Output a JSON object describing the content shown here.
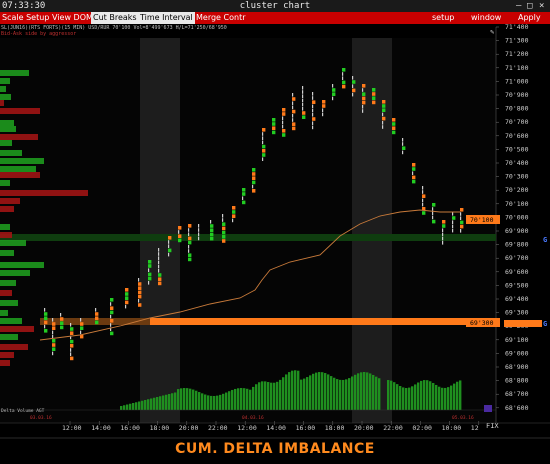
{
  "window": {
    "time": "07:33:30",
    "title": "cluster chart",
    "controls": [
      "–",
      "□",
      "×"
    ]
  },
  "menu": {
    "left": [
      "Scale Setup",
      "View DOM",
      "Cut Breaks",
      "Time Interval",
      "Merge Contr"
    ],
    "active": [
      "Cut Breaks",
      "Time Interval"
    ],
    "right": [
      "setup",
      "window",
      "Apply"
    ]
  },
  "info": {
    "line1": "SL(JUN16)(RTS FORTS)(15 MIN) USD/RUR   70'100  Vol=8'499'673  H/L=71'250/68'950",
    "line2": "Bid-Ask side by aggressor"
  },
  "price_axis": [
    "71'400",
    "71'300",
    "71'200",
    "71'100",
    "71'000",
    "70'900",
    "70'800",
    "70'700",
    "70'600",
    "70'500",
    "70'400",
    "70'300",
    "70'200",
    "70'100",
    "70'000",
    "69'900",
    "69'800",
    "69'700",
    "69'600",
    "69'500",
    "69'400",
    "69'300",
    "69'200",
    "69'100",
    "69'000",
    "68'900",
    "68'800",
    "68'700",
    "68'600"
  ],
  "price_tags": [
    {
      "label": "70'100",
      "color": "#ff7a1a"
    },
    {
      "label": "69'300",
      "color": "#ff7a1a"
    }
  ],
  "level_markers": [
    "G",
    "G"
  ],
  "time_axis": [
    "12:00",
    "14:00",
    "16:00",
    "18:00",
    "20:00",
    "22:00",
    "12:00",
    "14:00",
    "16:00",
    "18:00",
    "20:00",
    "22:00",
    "02:00",
    "10:00",
    "12"
  ],
  "small_labels": {
    "bottom_left": "Delta Volume AGT",
    "date_left": "03.03.16",
    "date_mid": "04.03.16",
    "date_right": "05.03.16",
    "fix": "FIX"
  },
  "caption": "CUM. DELTA IMBALANCE",
  "colors": {
    "menu_bg": "#c80000",
    "bid": "#22cc22",
    "ask": "#ff7a1a",
    "neutral": "#cfcfcf",
    "profile_green": "#1e9a1e",
    "profile_red": "#a01414",
    "caption": "#ff8a1e"
  }
}
